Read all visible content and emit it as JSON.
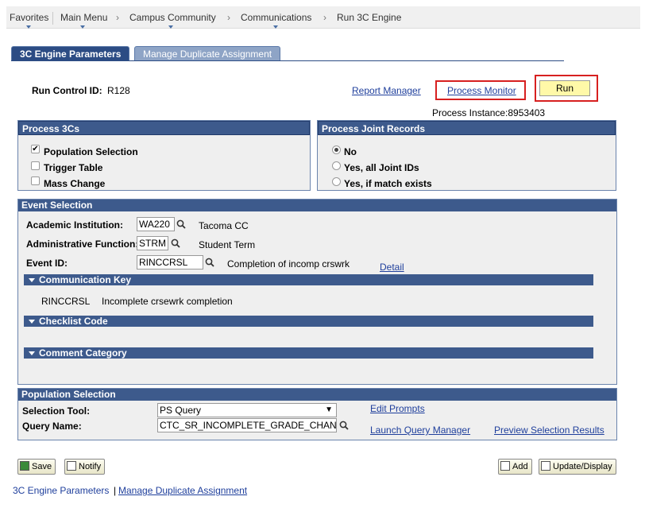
{
  "breadcrumb": {
    "favorites": "Favorites",
    "main_menu": "Main Menu",
    "campus_community": "Campus Community",
    "communications": "Communications",
    "current": "Run 3C Engine",
    "arrow": "›"
  },
  "tabs": [
    {
      "label": "3C Engine Parameters",
      "active": true
    },
    {
      "label": "Manage Duplicate Assignment",
      "active": false
    }
  ],
  "run_control": {
    "label": "Run Control ID:",
    "value": "R128"
  },
  "links": {
    "report_manager": "Report Manager",
    "process_monitor": "Process Monitor"
  },
  "run_button": "Run",
  "process_instance": "Process Instance:8953403",
  "process_3cs": {
    "title": "Process 3Cs",
    "items": [
      {
        "label": "Population Selection",
        "checked": true
      },
      {
        "label": "Trigger Table",
        "checked": false
      },
      {
        "label": "Mass Change",
        "checked": false
      }
    ],
    "check_glyph": "✔"
  },
  "joint_records": {
    "title": "Process Joint Records",
    "options": [
      {
        "label": "No",
        "selected": true
      },
      {
        "label": "Yes, all Joint IDs",
        "selected": false
      },
      {
        "label": "Yes, if match exists",
        "selected": false
      }
    ]
  },
  "event_selection": {
    "title": "Event Selection",
    "institution": {
      "label": "Academic Institution:",
      "value": "WA220",
      "desc": "Tacoma CC"
    },
    "admin_function": {
      "label": "Administrative Function:",
      "value": "STRM",
      "desc": "Student Term"
    },
    "event_id": {
      "label": "Event ID:",
      "value": "RINCCRSL",
      "desc": "Completion of incomp crswrk"
    },
    "detail_link": "Detail",
    "communication_key": {
      "title": "Communication Key",
      "code": "RINCCRSL",
      "desc": "Incomplete crsewrk completion"
    },
    "checklist_code": {
      "title": "Checklist Code"
    },
    "comment_category": {
      "title": "Comment Category"
    }
  },
  "population_selection": {
    "title": "Population Selection",
    "selection_tool": {
      "label": "Selection Tool:",
      "value": "PS Query"
    },
    "query_name": {
      "label": "Query Name:",
      "value": "CTC_SR_INCOMPLETE_GRADE_CHAN"
    },
    "edit_prompts": "Edit Prompts",
    "launch_query_manager": "Launch Query Manager",
    "preview_selection_results": "Preview Selection Results"
  },
  "toolbar": {
    "save": "Save",
    "notify": "Notify",
    "add": "Add",
    "update_display": "Update/Display"
  },
  "footer": {
    "link1": "3C Engine Parameters",
    "separator": "|",
    "link2": "Manage Duplicate Assignment"
  },
  "colors": {
    "header_blue": "#3d5a8c",
    "highlight_red": "#d72020",
    "run_yellow": "#fff9a8",
    "link_blue": "#1f3f9c"
  }
}
